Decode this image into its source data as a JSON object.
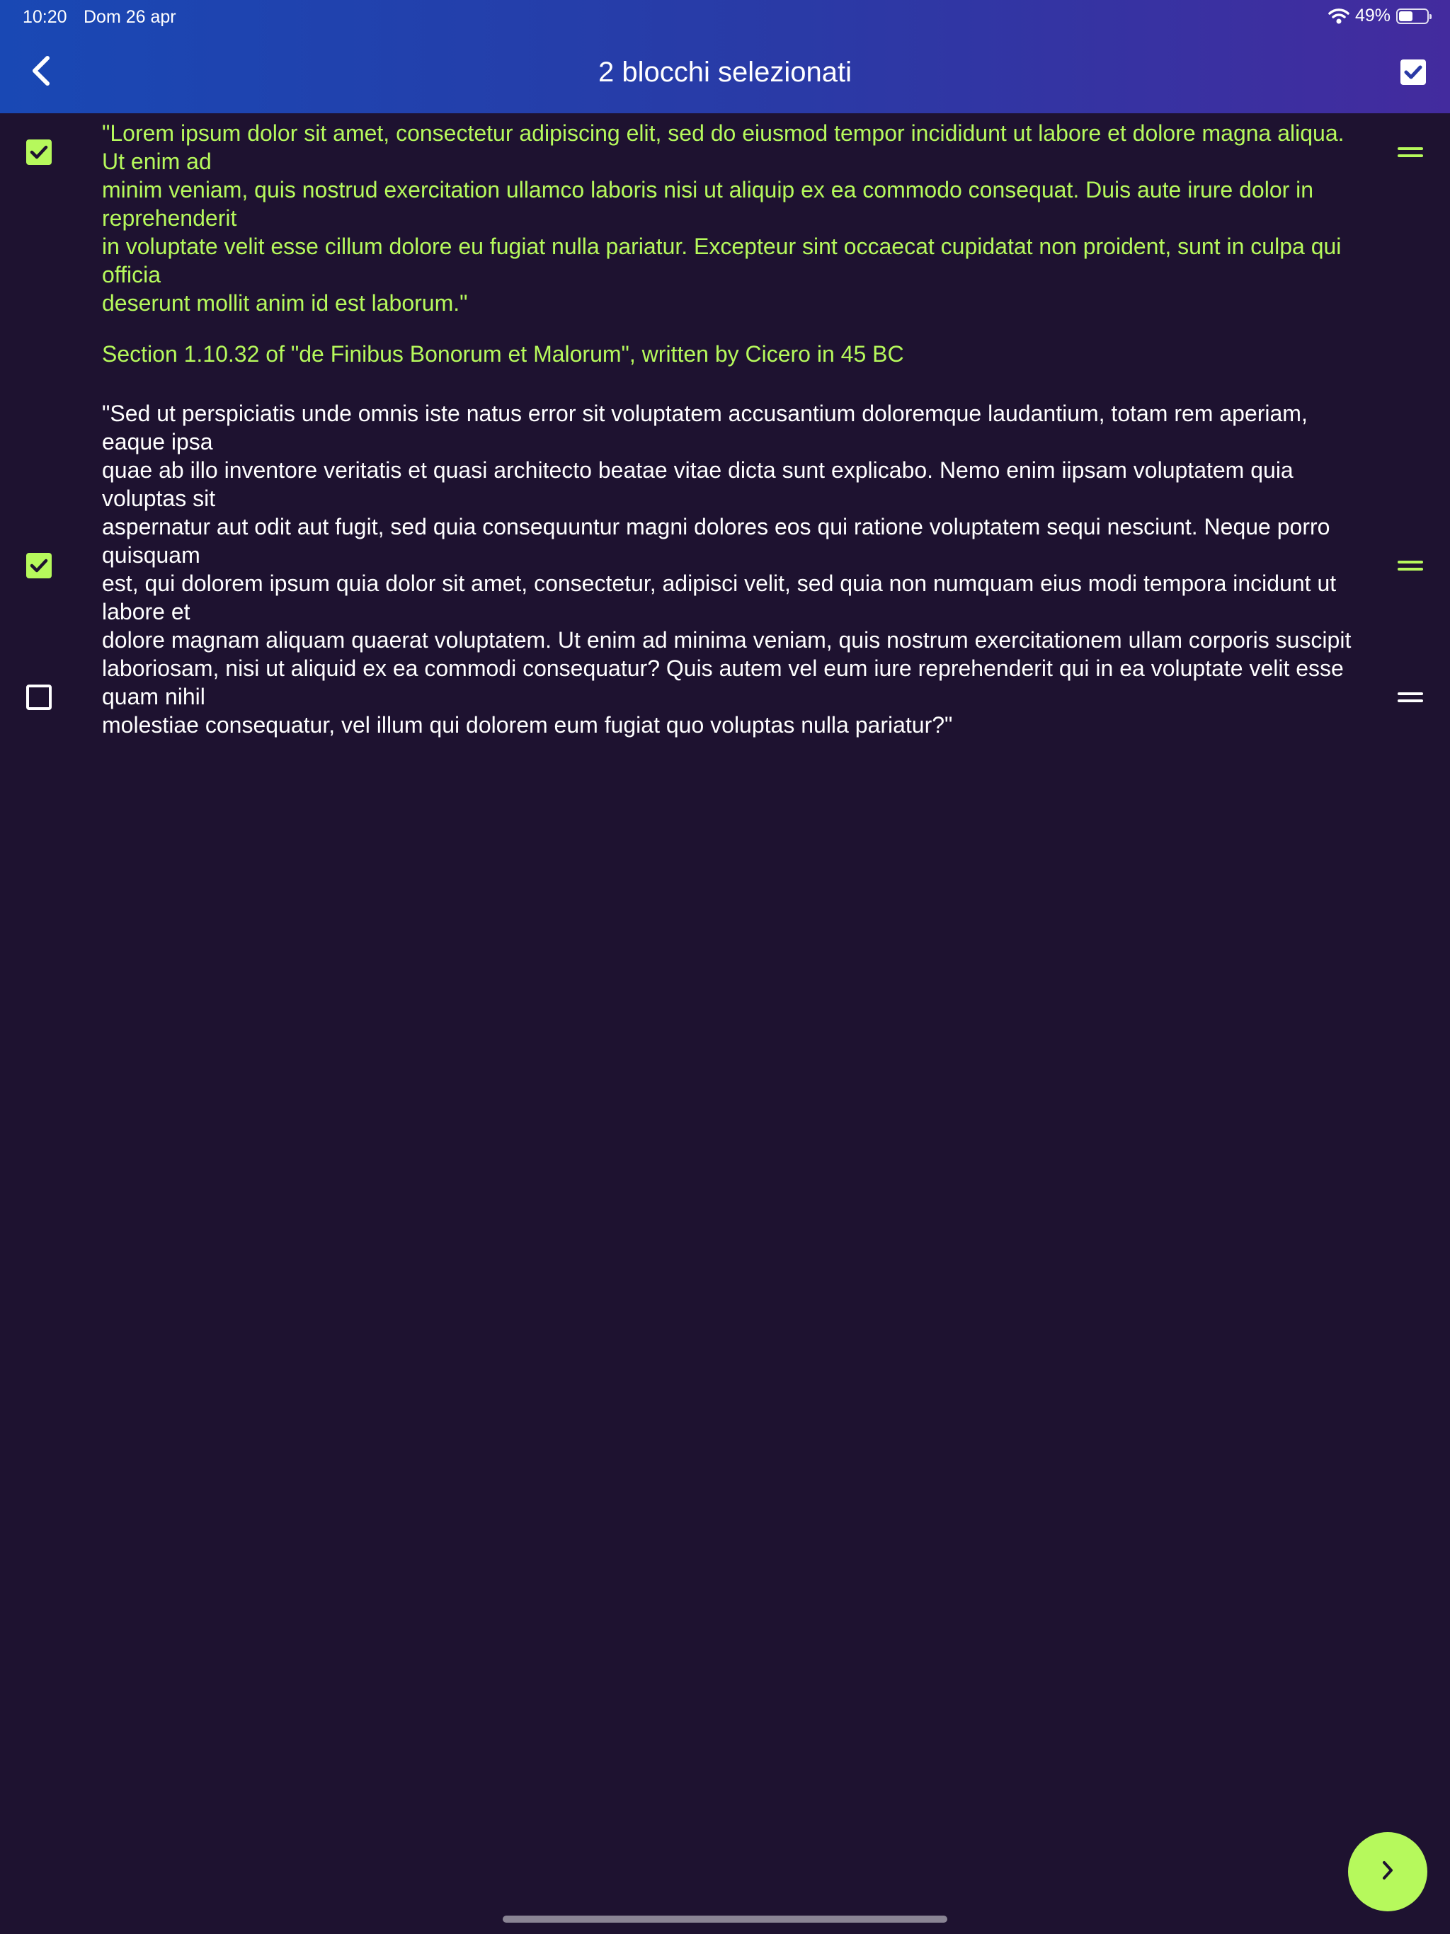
{
  "status_bar": {
    "time": "10:20",
    "date": "Dom 26 apr",
    "battery_percent": "49%",
    "battery_level": 0.49
  },
  "nav": {
    "back_icon": "chevron-left-icon",
    "title": "2 blocchi selezionati",
    "select_all_icon": "checkbox-checked-icon"
  },
  "colors": {
    "background": "#1e1230",
    "header_gradient_start": "#1948b4",
    "header_gradient_end": "#432b9e",
    "accent": "#b6f95c",
    "text": "#ffffff"
  },
  "blocks": [
    {
      "selected": true,
      "text": "\"Lorem ipsum dolor sit amet, consectetur adipiscing elit, sed do eiusmod tempor incididunt ut labore et dolore magna aliqua. Ut enim ad\nminim veniam, quis nostrud exercitation ullamco laboris nisi ut aliquip ex ea commodo consequat. Duis aute irure dolor in reprehenderit\nin voluptate velit esse cillum dolore eu fugiat nulla pariatur. Excepteur sint occaecat cupidatat non proident, sunt in culpa qui officia\ndeserunt mollit anim id est laborum.\""
    },
    {
      "selected": true,
      "text": "Section 1.10.32 of \"de Finibus Bonorum et Malorum\", written by Cicero in 45 BC"
    },
    {
      "selected": false,
      "text": "\"Sed ut perspiciatis unde omnis iste natus error sit voluptatem accusantium doloremque laudantium, totam rem aperiam, eaque ipsa\nquae ab illo inventore veritatis et quasi architecto beatae vitae dicta sunt explicabo. Nemo enim iipsam voluptatem quia voluptas sit\naspernatur aut odit aut fugit, sed quia consequuntur magni dolores eos qui ratione voluptatem sequi nesciunt. Neque porro quisquam\nest, qui dolorem ipsum quia dolor sit amet, consectetur, adipisci velit, sed quia non numquam eius modi tempora incidunt ut labore et\ndolore magnam aliquam quaerat voluptatem. Ut enim ad minima veniam, quis nostrum exercitationem ullam corporis suscipit\nlaboriosam, nisi ut aliquid ex ea commodi consequatur? Quis autem vel eum iure reprehenderit qui in ea voluptate velit esse quam nihil\nmolestiae consequatur, vel illum qui dolorem eum fugiat quo voluptas nulla pariatur?\""
    }
  ],
  "fab": {
    "icon": "chevron-right-icon"
  }
}
